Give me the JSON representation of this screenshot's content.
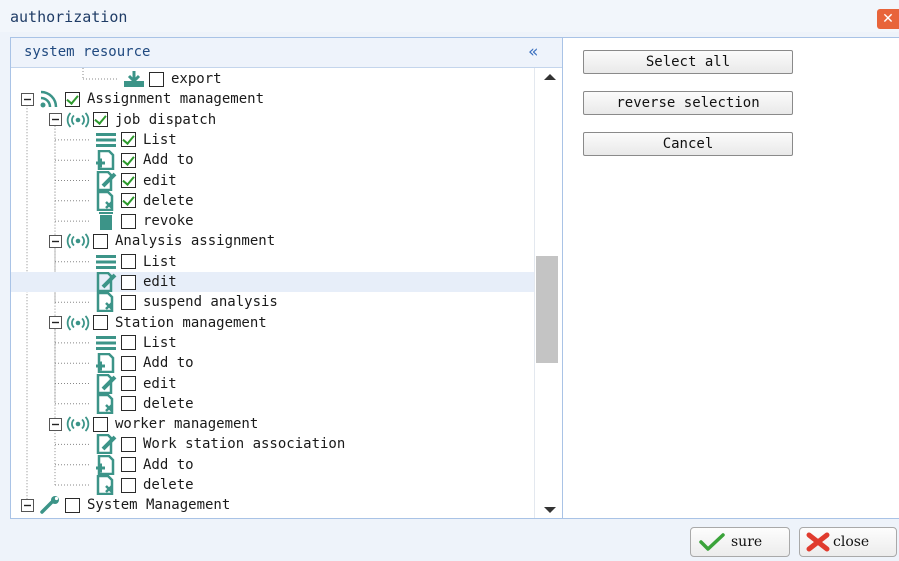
{
  "window": {
    "title": "authorization",
    "close_glyph": "✕"
  },
  "left_panel": {
    "title": "system resource",
    "collapse_glyph": "«"
  },
  "tree": [
    {
      "label": "export",
      "level": 3,
      "checked": false,
      "icon": "export-icon",
      "toggle": "none"
    },
    {
      "label": "Assignment management",
      "level": 0,
      "checked": true,
      "icon": "rss-icon",
      "toggle": "minus"
    },
    {
      "label": "job dispatch",
      "level": 1,
      "checked": true,
      "icon": "signal-icon",
      "toggle": "minus"
    },
    {
      "label": "List",
      "level": 2,
      "checked": true,
      "icon": "list-icon",
      "toggle": "none"
    },
    {
      "label": "Add to",
      "level": 2,
      "checked": true,
      "icon": "add-doc-icon",
      "toggle": "none"
    },
    {
      "label": "edit",
      "level": 2,
      "checked": true,
      "icon": "edit-doc-icon",
      "toggle": "none"
    },
    {
      "label": "delete",
      "level": 2,
      "checked": true,
      "icon": "delete-doc-icon",
      "toggle": "none"
    },
    {
      "label": "revoke",
      "level": 2,
      "checked": false,
      "icon": "trash-icon",
      "toggle": "none"
    },
    {
      "label": "Analysis assignment",
      "level": 1,
      "checked": false,
      "icon": "signal-icon",
      "toggle": "minus"
    },
    {
      "label": "List",
      "level": 2,
      "checked": false,
      "icon": "list-icon",
      "toggle": "none"
    },
    {
      "label": "edit",
      "level": 2,
      "checked": false,
      "icon": "edit-doc-icon",
      "toggle": "none",
      "highlight": true
    },
    {
      "label": "suspend analysis",
      "level": 2,
      "checked": false,
      "icon": "delete-doc-icon",
      "toggle": "none"
    },
    {
      "label": "Station management",
      "level": 1,
      "checked": false,
      "icon": "signal-icon",
      "toggle": "minus"
    },
    {
      "label": "List",
      "level": 2,
      "checked": false,
      "icon": "list-icon",
      "toggle": "none"
    },
    {
      "label": "Add to",
      "level": 2,
      "checked": false,
      "icon": "add-doc-icon",
      "toggle": "none"
    },
    {
      "label": "edit",
      "level": 2,
      "checked": false,
      "icon": "edit-doc-icon",
      "toggle": "none"
    },
    {
      "label": "delete",
      "level": 2,
      "checked": false,
      "icon": "delete-doc-icon",
      "toggle": "none"
    },
    {
      "label": "worker management",
      "level": 1,
      "checked": false,
      "icon": "signal-icon",
      "toggle": "minus"
    },
    {
      "label": "Work station association",
      "level": 2,
      "checked": false,
      "icon": "edit-doc-icon",
      "toggle": "none"
    },
    {
      "label": "Add to",
      "level": 2,
      "checked": false,
      "icon": "add-doc-icon",
      "toggle": "none"
    },
    {
      "label": "delete",
      "level": 2,
      "checked": false,
      "icon": "delete-doc-icon",
      "toggle": "none"
    },
    {
      "label": "System Management",
      "level": 0,
      "checked": false,
      "icon": "wrench-icon",
      "toggle": "minus"
    }
  ],
  "actions": {
    "select_all": "Select all",
    "reverse_selection": "reverse selection",
    "cancel": "Cancel"
  },
  "footer": {
    "sure": "sure",
    "close": "close"
  },
  "colors": {
    "accent": "#3a6fbf",
    "check": "#2d9a2d",
    "icon_teal": "#3c9488",
    "close_red": "#e03b2e",
    "title_close": "#e8643a"
  }
}
